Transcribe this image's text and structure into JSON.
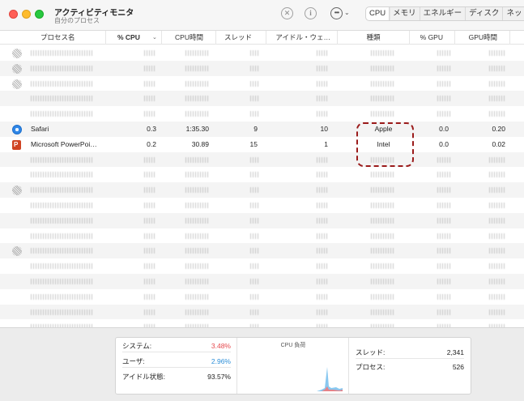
{
  "app": {
    "title": "アクティビティモニタ",
    "subtitle": "自分のプロセス"
  },
  "tabs": [
    "CPU",
    "メモリ",
    "エネルギー",
    "ディスク",
    "ネット"
  ],
  "columns": {
    "name": "プロセス名",
    "cpu": "% CPU",
    "cpu_time": "CPU時間",
    "threads": "スレッド",
    "idle_wake": "アイドル・ウェ…",
    "kind": "種類",
    "gpu": "% GPU",
    "gpu_time": "GPU時間"
  },
  "processes": [
    {
      "name": "Safari",
      "cpu": "0.3",
      "cpu_time": "1:35.30",
      "threads": "9",
      "idle_wake": "10",
      "kind": "Apple",
      "gpu": "0.0",
      "gpu_time": "0.20",
      "icon": "safari-icon"
    },
    {
      "name": "Microsoft PowerPoi…",
      "cpu": "0.2",
      "cpu_time": "30.89",
      "threads": "15",
      "idle_wake": "1",
      "kind": "Intel",
      "gpu": "0.0",
      "gpu_time": "0.02",
      "icon": "powerpoint-icon"
    }
  ],
  "footer": {
    "system_label": "システム:",
    "system_value": "3.48%",
    "user_label": "ユーザ:",
    "user_value": "2.96%",
    "idle_label": "アイドル状態:",
    "idle_value": "93.57%",
    "graph_title": "CPU 負荷",
    "threads_label": "スレッド:",
    "threads_value": "2,341",
    "processes_label": "プロセス:",
    "processes_value": "526"
  },
  "colors": {
    "system": "#e5484d",
    "user": "#2d8fd8",
    "highlight": "#9b1b1b"
  }
}
